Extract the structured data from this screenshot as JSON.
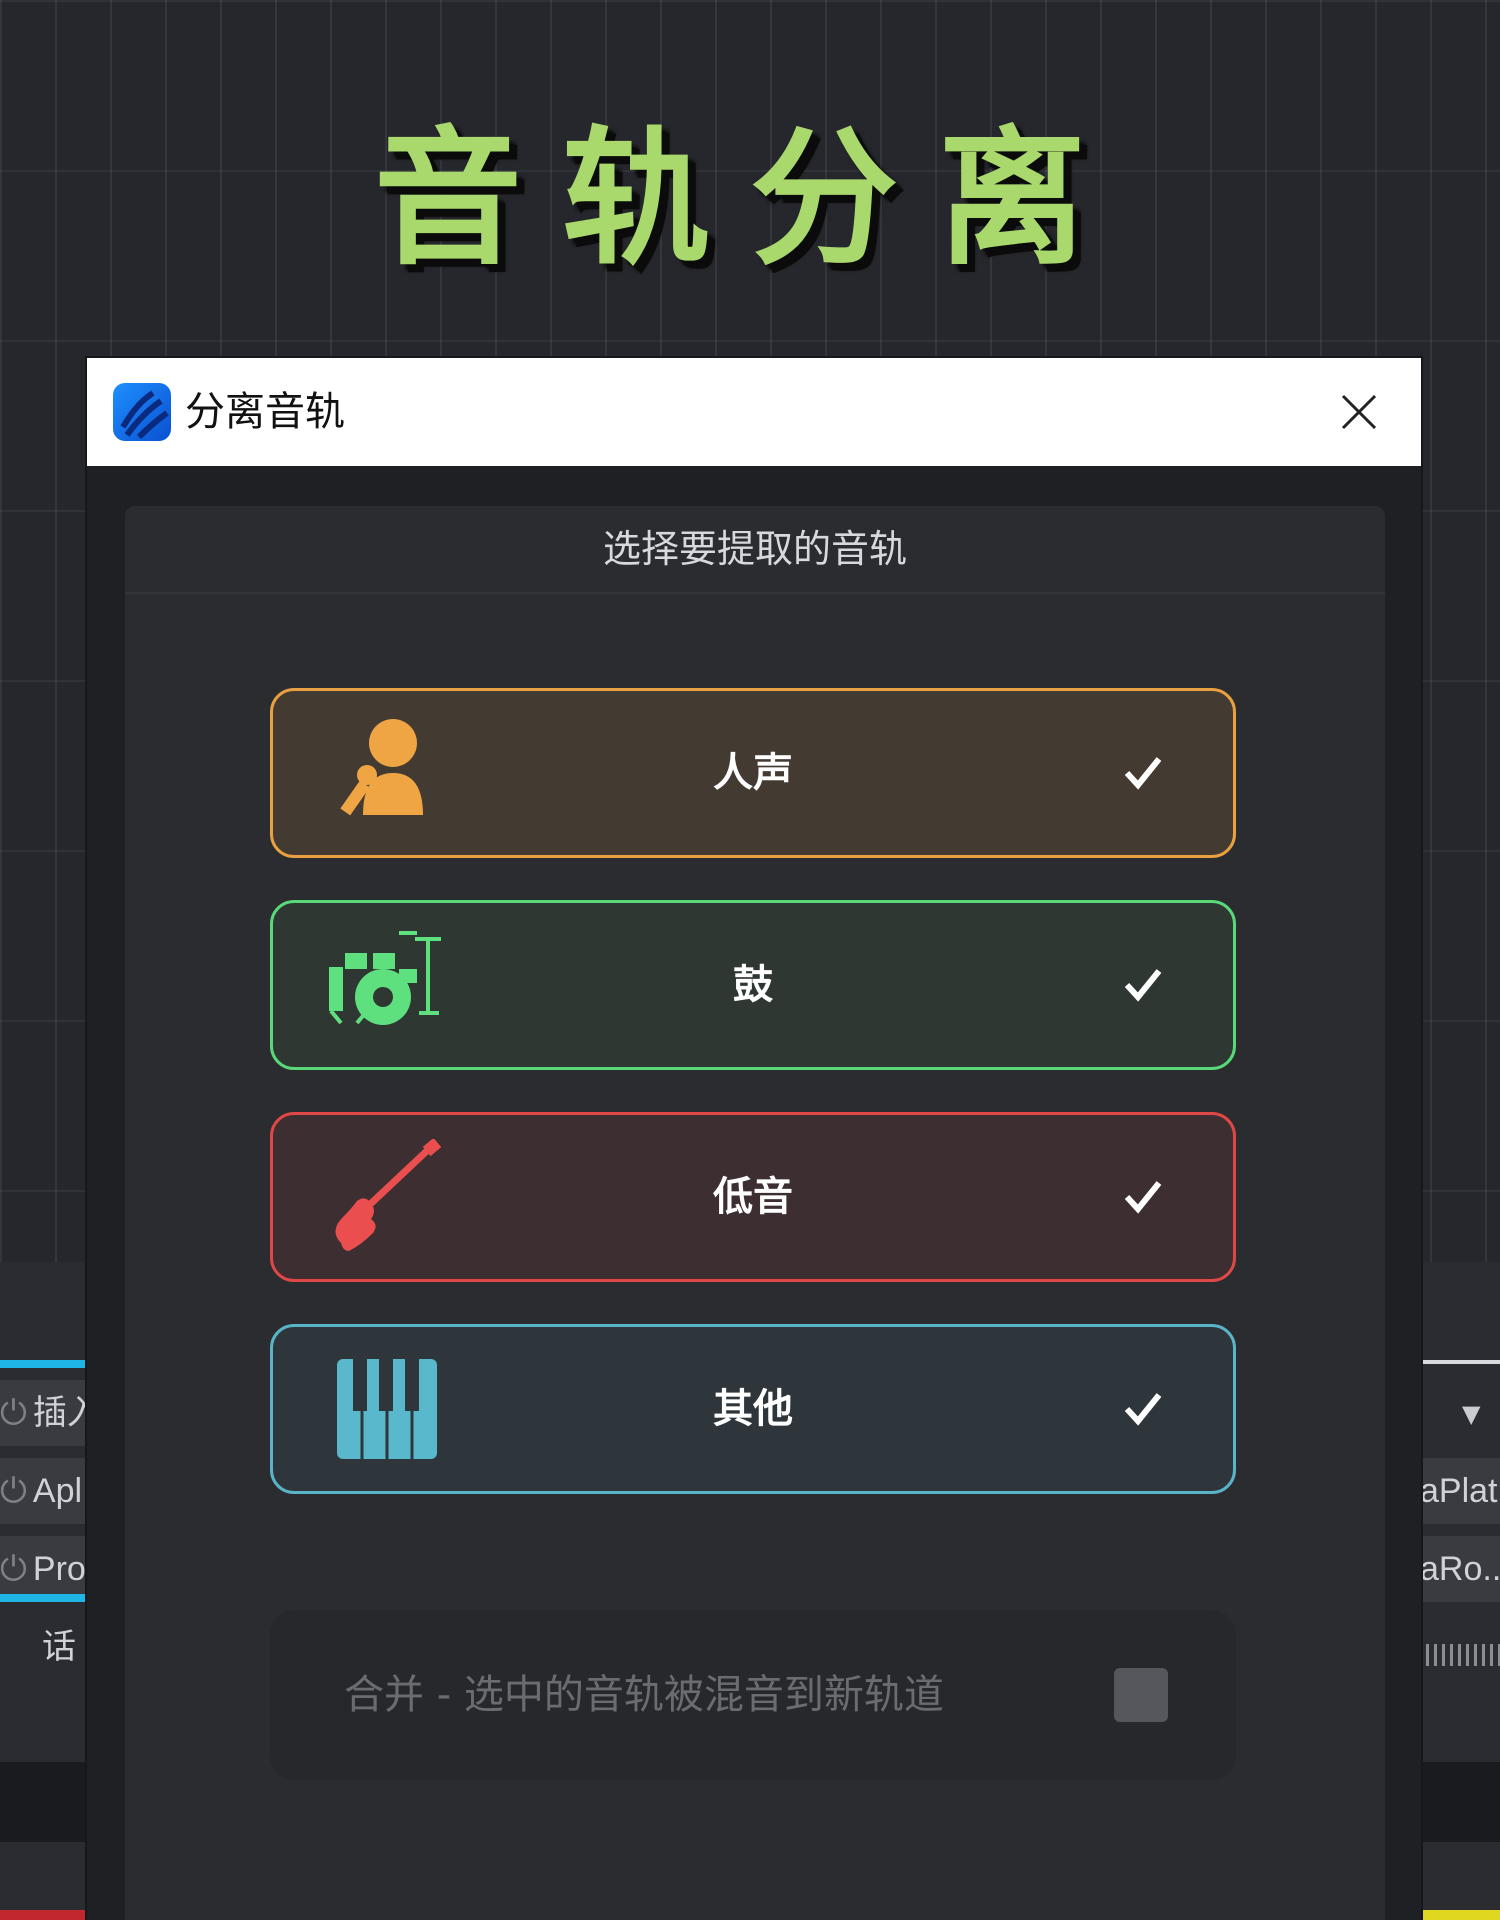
{
  "headline": "音轨分离",
  "dialog": {
    "title": "分离音轨",
    "close_label": "×",
    "panel_title": "选择要提取的音轨",
    "tracks": [
      {
        "label": "人声",
        "icon": "microphone-person-icon",
        "color": "#e8a040",
        "bg": "#433a31",
        "checked": true
      },
      {
        "label": "鼓",
        "icon": "drum-kit-icon",
        "color": "#58d878",
        "bg": "#2f3733",
        "checked": true
      },
      {
        "label": "低音",
        "icon": "bass-guitar-icon",
        "color": "#e04848",
        "bg": "#3d2e31",
        "checked": true
      },
      {
        "label": "其他",
        "icon": "piano-keys-icon",
        "color": "#5ab4c8",
        "bg": "#2f363b",
        "checked": true
      }
    ],
    "merge": {
      "label": "合并 - 选中的音轨被混音到新轨道",
      "checked": false
    }
  },
  "background": {
    "left_rows": [
      "插入",
      "Apl",
      "Pro",
      "话"
    ],
    "right_rows": [
      "aPlat",
      "aRo..."
    ]
  }
}
